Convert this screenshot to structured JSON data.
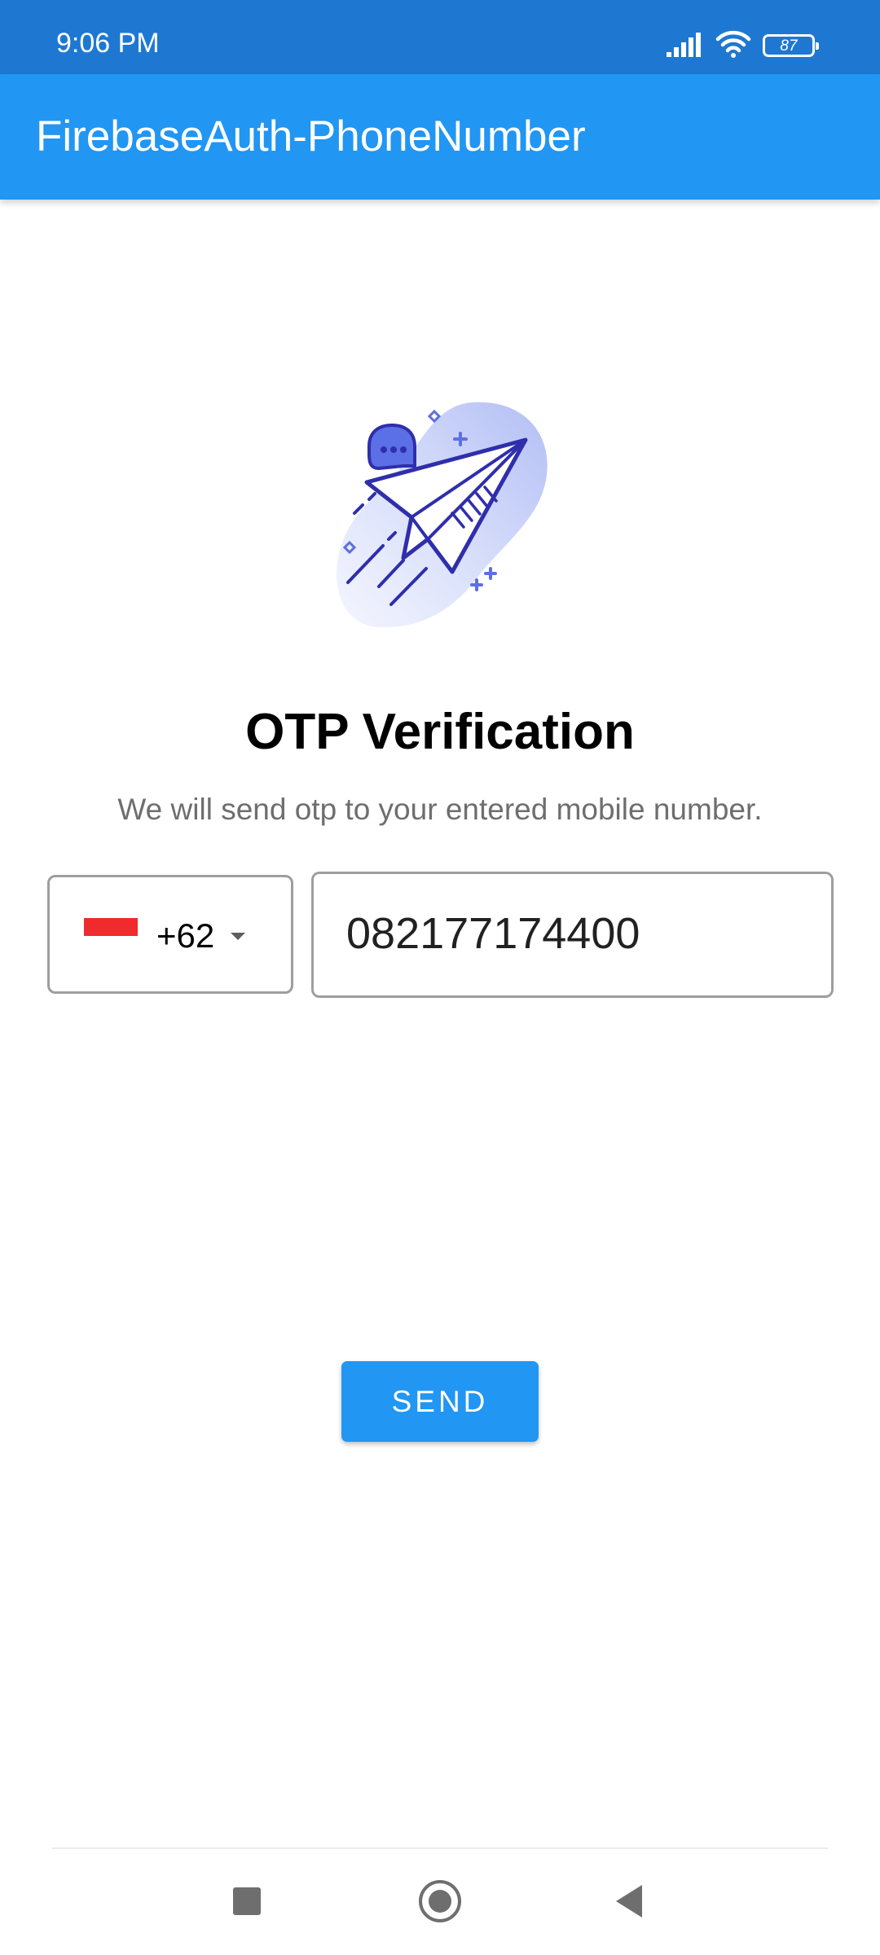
{
  "status_bar": {
    "time": "9:06 PM",
    "battery_level": "87",
    "icons": [
      "signal-icon",
      "wifi-icon",
      "battery-icon"
    ]
  },
  "app_bar": {
    "title": "FirebaseAuth-PhoneNumber"
  },
  "main": {
    "illustration": "paper-plane-chat-illustration",
    "heading": "OTP Verification",
    "subheading": "We will send otp to your entered mobile number.",
    "country_picker": {
      "flag": "indonesia-flag",
      "dial_code": "+62"
    },
    "phone_input": {
      "value": "082177174400"
    },
    "send_label": "SEND"
  },
  "nav_bar": {
    "buttons": [
      "recents",
      "home",
      "back"
    ]
  },
  "colors": {
    "status_bar": "#1e78d2",
    "app_bar": "#2196f3",
    "button": "#2196f3",
    "illustration_primary": "#2f2eab",
    "illustration_fill": "#5b6fe6",
    "flag_red": "#ef2b2d"
  }
}
